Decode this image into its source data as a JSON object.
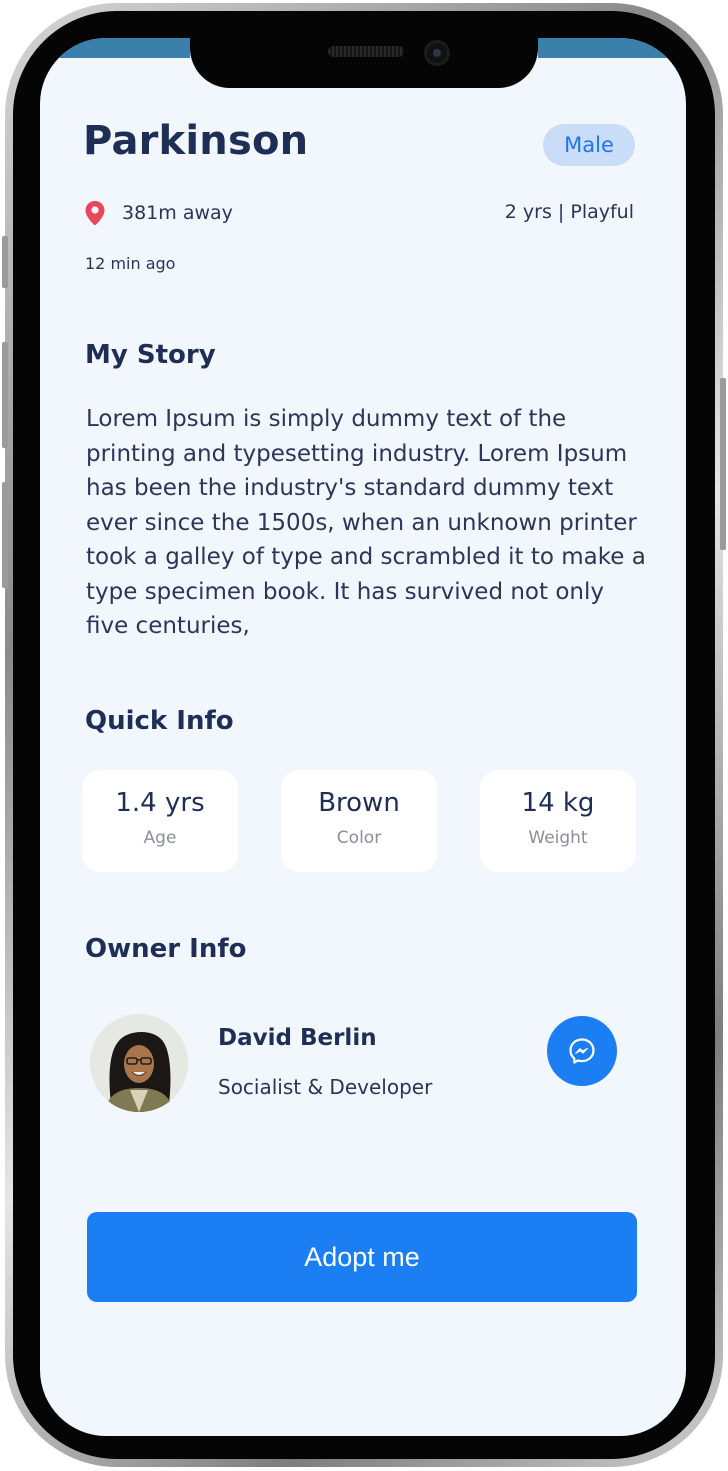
{
  "pet": {
    "name": "Parkinson",
    "gender": "Male",
    "distance": "381m away",
    "age_temperament": "2 yrs | Playful",
    "posted": "12 min ago"
  },
  "story": {
    "heading": "My Story",
    "text": "Lorem Ipsum is simply dummy text of the printing and typesetting industry. Lorem Ipsum has been the industry's standard dummy text ever since the 1500s, when an unknown printer took a galley of type and scrambled it to make a type specimen book. It has survived not only five centuries,"
  },
  "quick_info": {
    "heading": "Quick Info",
    "items": [
      {
        "value": "1.4 yrs",
        "label": "Age"
      },
      {
        "value": "Brown",
        "label": "Color"
      },
      {
        "value": "14 kg",
        "label": "Weight"
      }
    ]
  },
  "owner": {
    "heading": "Owner Info",
    "name": "David Berlin",
    "role": "Socialist & Developer"
  },
  "actions": {
    "adopt_label": "Adopt me"
  },
  "icons": {
    "location": "location-pin-icon",
    "messenger": "messenger-icon"
  },
  "colors": {
    "primary": "#1c7ef3",
    "heading": "#1e2e54",
    "badge_bg": "#c9dcf8",
    "pin": "#e8475a",
    "screen_bg": "#f2f6fd"
  }
}
